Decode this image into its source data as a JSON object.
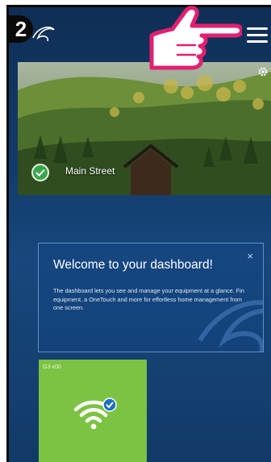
{
  "header": {
    "step_number": "2",
    "menu_icon": "hamburger-menu-icon",
    "brand_icon": "brand-swoosh-icon",
    "hand_icon": "pointing-hand-icon"
  },
  "location": {
    "name": "Main Street",
    "status_icon": "check-circle-icon",
    "settings_icon": "gear-icon"
  },
  "welcome": {
    "title": "Welcome to your dashboard!",
    "close_label": "×",
    "body": "The dashboard lets you see and manage your equipment at a glance. Fin equipment, a OneTouch and more for effortless home management from one screen."
  },
  "device": {
    "label": "G3-x00",
    "icon": "wifi-icon",
    "status_icon": "check-badge-icon"
  },
  "colors": {
    "background": "#0f2f57",
    "accent_green": "#7cc243",
    "check_green": "#3aa64a",
    "callout_pink": "#e2206f"
  }
}
